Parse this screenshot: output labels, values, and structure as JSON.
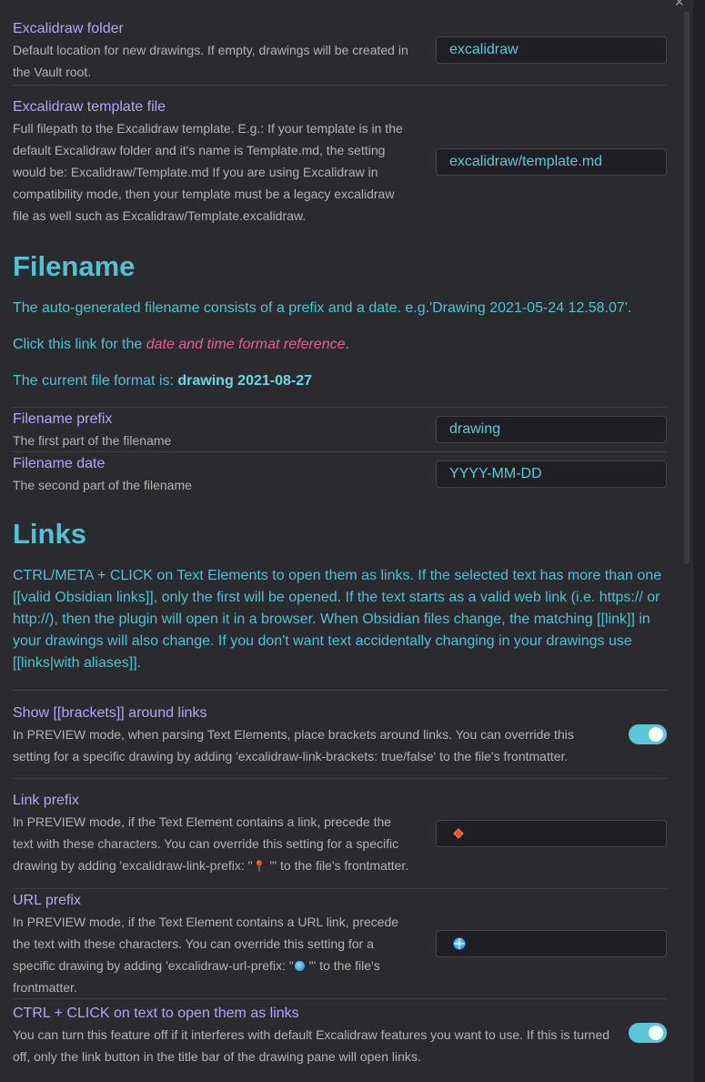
{
  "close_label": "×",
  "folder_setting": {
    "name": "Excalidraw folder",
    "desc": "Default location for new drawings. If empty, drawings will be created in the Vault root.",
    "value": "excalidraw"
  },
  "template_setting": {
    "name": "Excalidraw template file",
    "desc": "Full filepath to the Excalidraw template. E.g.: If your template is in the default Excalidraw folder and it's name is Template.md, the setting would be: Excalidraw/Template.md If you are using Excalidraw in compatibility mode, then your template must be a legacy excalidraw file as well such as Excalidraw/Template.excalidraw.",
    "value": "excalidraw/template.md"
  },
  "filename_section": {
    "heading": "Filename",
    "intro": "The auto-generated filename consists of a prefix and a date. e.g.'Drawing 2021-05-24 12.58.07'.",
    "link_prefix_text": "Click this link for the ",
    "link_text": "date and time format reference",
    "link_suffix_text": ".",
    "current_prefix_text": "The current file format is: ",
    "current_format": "drawing 2021-08-27"
  },
  "filename_prefix": {
    "name": "Filename prefix",
    "desc": "The first part of the filename",
    "value": "drawing"
  },
  "filename_date": {
    "name": "Filename date",
    "desc": "The second part of the filename",
    "value": "YYYY-MM-DD"
  },
  "links_section": {
    "heading": "Links",
    "intro": "CTRL/META + CLICK on Text Elements to open them as links. If the selected text has more than one [[valid Obsidian links]], only the first will be opened. If the text starts as a valid web link (i.e. https:// or http://), then the plugin will open it in a browser. When Obsidian files change, the matching [[link]] in your drawings will also change. If you don't want text accidentally changing in your drawings use [[links|with aliases]]."
  },
  "show_brackets": {
    "name": "Show [[brackets]] around links",
    "desc": "In PREVIEW mode, when parsing Text Elements, place brackets around links. You can override this setting for a specific drawing by adding 'excalidraw-link-brackets: true/false' to the file's frontmatter.",
    "enabled": true
  },
  "link_prefix": {
    "name": "Link prefix",
    "desc_a": "In PREVIEW mode, if the Text Element contains a link, precede the text with these characters. You can override this setting for a specific drawing by adding 'excalidraw-link-prefix: \"",
    "desc_emoji": "📍",
    "desc_b": " \"' to the file's frontmatter.",
    "value_icon": "orange-diamond-icon"
  },
  "url_prefix": {
    "name": "URL prefix",
    "desc_a": "In PREVIEW mode, if the Text Element contains a URL link, precede the text with these characters. You can override this setting for a specific drawing by adding 'excalidraw-url-prefix: \"",
    "desc_b": " \"' to the file's frontmatter.",
    "value_icon": "globe-icon"
  },
  "ctrl_click": {
    "name": "CTRL + CLICK on text to open them as links",
    "desc": "You can turn this feature off if it interferes with default Excalidraw features you want to use. If this is turned off, only the link button in the title bar of the drawing pane will open links.",
    "enabled": true
  },
  "colors": {
    "background": "#2b2b2f",
    "setting_name": "#b7a2ff",
    "accent": "#4fc1d3",
    "link": "#e0609a",
    "toggle_on": "#5ac6d6"
  }
}
